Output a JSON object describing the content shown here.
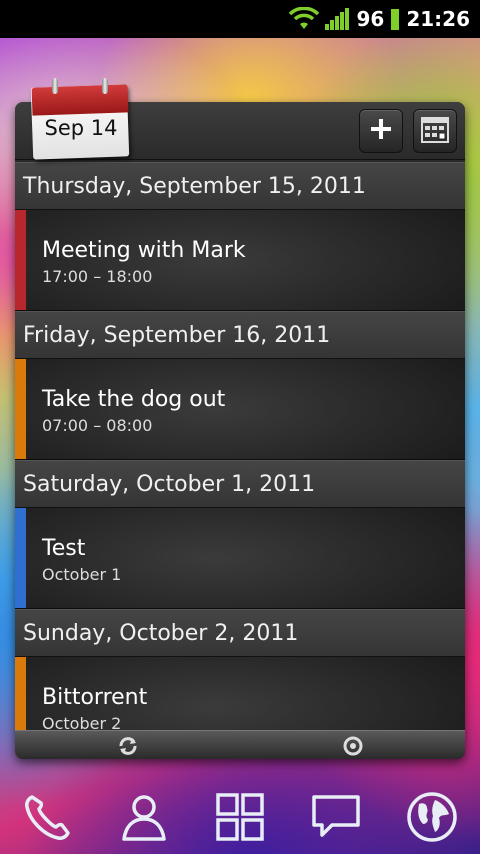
{
  "status_bar": {
    "battery": "96",
    "time": "21:26",
    "icons": [
      "wifi-icon",
      "signal-icon",
      "battery-icon"
    ]
  },
  "widget": {
    "date_badge": "Sep 14",
    "actions": [
      "add-icon",
      "calendar-grid-icon"
    ],
    "days": [
      {
        "header": "Thursday, September 15, 2011",
        "events": [
          {
            "title": "Meeting with Mark",
            "time": "17:00 – 18:00",
            "color": "#b8272c"
          }
        ]
      },
      {
        "header": "Friday, September 16, 2011",
        "events": [
          {
            "title": "Take the dog out",
            "time": "07:00 – 08:00",
            "color": "#d97a0a"
          }
        ]
      },
      {
        "header": "Saturday, October 1, 2011",
        "events": [
          {
            "title": "Test",
            "time": "October 1",
            "color": "#2f6fd0"
          }
        ]
      },
      {
        "header": "Sunday, October 2, 2011",
        "events": [
          {
            "title": "Bittorrent",
            "time": "October 2",
            "color": "#d97a0a"
          }
        ]
      }
    ],
    "footer_icons": [
      "refresh-icon",
      "settings-icon"
    ]
  },
  "dock": {
    "items": [
      "phone-icon",
      "contacts-icon",
      "apps-grid-icon",
      "messages-icon",
      "browser-globe-icon"
    ]
  }
}
